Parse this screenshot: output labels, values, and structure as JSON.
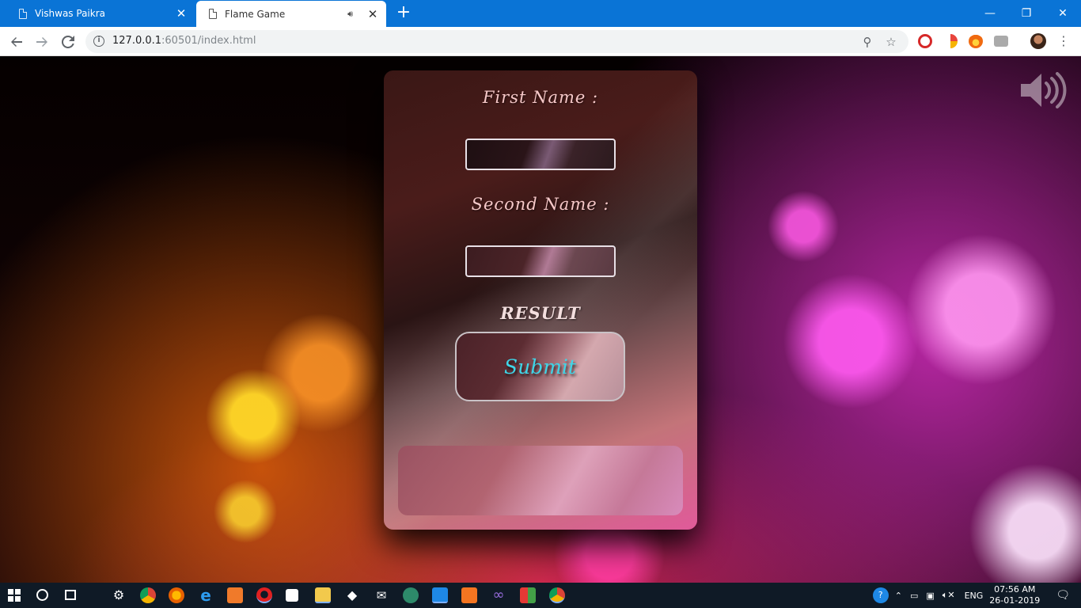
{
  "browser": {
    "tabs": [
      {
        "title": "Vishwas Paikra",
        "active": false
      },
      {
        "title": "Flame Game",
        "active": true,
        "audio": true
      }
    ],
    "new_tab_label": "+",
    "window_controls": {
      "minimize": "—",
      "restore": "❐",
      "close": "✕"
    },
    "url_host": "127.0.0.1",
    "url_rest": ":60501/index.html",
    "back_icon": "arrow-left-icon",
    "forward_icon": "arrow-right-icon",
    "reload_icon": "reload-icon"
  },
  "form": {
    "first_name_label": "First Name :",
    "second_name_label": "Second Name :",
    "result_label": "RESULT",
    "submit_label": "Submit",
    "first_name_value": "",
    "second_name_value": "",
    "result_value": ""
  },
  "taskbar": {
    "language": "ENG",
    "time": "07:56 AM",
    "date": "26-01-2019"
  },
  "colors": {
    "tabbar": "#0a74d6",
    "submit_text": "#3ed6e8",
    "label_text": "#f6c8c8"
  }
}
